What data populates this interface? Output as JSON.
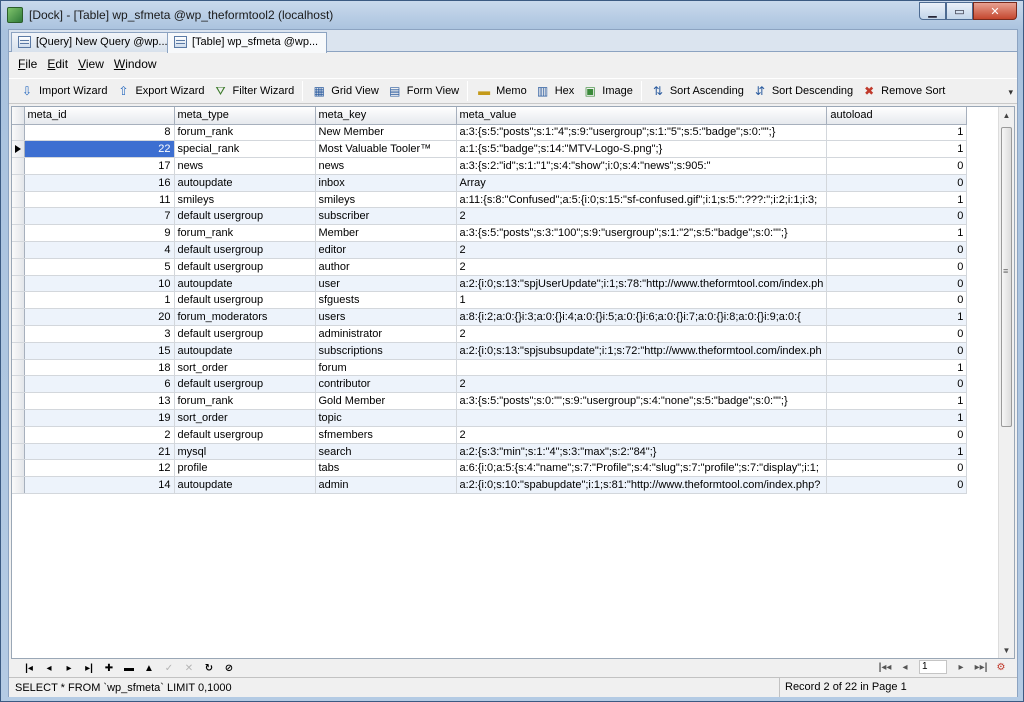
{
  "window": {
    "title": "[Dock] - [Table] wp_sfmeta @wp_theformtool2 (localhost)"
  },
  "tabs": [
    {
      "label": "[Query] New Query @wp..."
    },
    {
      "label": "[Table] wp_sfmeta @wp..."
    }
  ],
  "menu": [
    {
      "label": "File",
      "accel": "F",
      "rest": "ile"
    },
    {
      "label": "Edit",
      "accel": "E",
      "rest": "dit"
    },
    {
      "label": "View",
      "accel": "V",
      "rest": "iew"
    },
    {
      "label": "Window",
      "accel": "W",
      "rest": "indow"
    }
  ],
  "toolbar": {
    "import_wizard": "Import Wizard",
    "export_wizard": "Export Wizard",
    "filter_wizard": "Filter Wizard",
    "grid_view": "Grid View",
    "form_view": "Form View",
    "memo": "Memo",
    "hex": "Hex",
    "image": "Image",
    "sort_ascending": "Sort Ascending",
    "sort_descending": "Sort Descending",
    "remove_sort": "Remove Sort"
  },
  "grid": {
    "columns": [
      "meta_id",
      "meta_type",
      "meta_key",
      "meta_value",
      "autoload"
    ],
    "rows": [
      [
        "8",
        "forum_rank",
        "New Member",
        "a:3:{s:5:\"posts\";s:1:\"4\";s:9:\"usergroup\";s:1:\"5\";s:5:\"badge\";s:0:\"\";}",
        "1"
      ],
      [
        "22",
        "special_rank",
        "Most Valuable Tooler™",
        "a:1:{s:5:\"badge\";s:14:\"MTV-Logo-S.png\";}",
        "1"
      ],
      [
        "17",
        "news",
        "news",
        "a:3:{s:2:\"id\";s:1:\"1\";s:4:\"show\";i:0;s:4:\"news\";s:905:\"",
        "0"
      ],
      [
        "16",
        "autoupdate",
        "inbox",
        "Array",
        "0"
      ],
      [
        "11",
        "smileys",
        "smileys",
        "a:11:{s:8:\"Confused\";a:5:{i:0;s:15:\"sf-confused.gif\";i:1;s:5:\":???:\";i:2;i:1;i:3;",
        "1"
      ],
      [
        "7",
        "default usergroup",
        "subscriber",
        "2",
        "0"
      ],
      [
        "9",
        "forum_rank",
        "Member",
        "a:3:{s:5:\"posts\";s:3:\"100\";s:9:\"usergroup\";s:1:\"2\";s:5:\"badge\";s:0:\"\";}",
        "1"
      ],
      [
        "4",
        "default usergroup",
        "editor",
        "2",
        "0"
      ],
      [
        "5",
        "default usergroup",
        "author",
        "2",
        "0"
      ],
      [
        "10",
        "autoupdate",
        "user",
        "a:2:{i:0;s:13:\"spjUserUpdate\";i:1;s:78:\"http://www.theformtool.com/index.ph",
        "0"
      ],
      [
        "1",
        "default usergroup",
        "sfguests",
        "1",
        "0"
      ],
      [
        "20",
        "forum_moderators",
        "users",
        "a:8:{i:2;a:0:{}i:3;a:0:{}i:4;a:0:{}i:5;a:0:{}i:6;a:0:{}i:7;a:0:{}i:8;a:0:{}i:9;a:0:{",
        "1"
      ],
      [
        "3",
        "default usergroup",
        "administrator",
        "2",
        "0"
      ],
      [
        "15",
        "autoupdate",
        "subscriptions",
        "a:2:{i:0;s:13:\"spjsubsupdate\";i:1;s:72:\"http://www.theformtool.com/index.ph",
        "0"
      ],
      [
        "18",
        "sort_order",
        "forum",
        "",
        "1"
      ],
      [
        "6",
        "default usergroup",
        "contributor",
        "2",
        "0"
      ],
      [
        "13",
        "forum_rank",
        "Gold Member",
        "a:3:{s:5:\"posts\";s:0:\"\";s:9:\"usergroup\";s:4:\"none\";s:5:\"badge\";s:0:\"\";}",
        "1"
      ],
      [
        "19",
        "sort_order",
        "topic",
        "",
        "1"
      ],
      [
        "2",
        "default usergroup",
        "sfmembers",
        "2",
        "0"
      ],
      [
        "21",
        "mysql",
        "search",
        "a:2:{s:3:\"min\";s:1:\"4\";s:3:\"max\";s:2:\"84\";}",
        "1"
      ],
      [
        "12",
        "profile",
        "tabs",
        "a:6:{i:0;a:5:{s:4:\"name\";s:7:\"Profile\";s:4:\"slug\";s:7:\"profile\";s:7:\"display\";i:1;",
        "0"
      ],
      [
        "14",
        "autoupdate",
        "admin",
        "a:2:{i:0;s:10:\"spabupdate\";i:1;s:81:\"http://www.theformtool.com/index.php?",
        "0"
      ]
    ],
    "selected_row": 1
  },
  "navigator": {
    "page_value": "1"
  },
  "status": {
    "sql": "SELECT * FROM `wp_sfmeta` LIMIT 0,1000",
    "record": "Record 2 of 22 in Page 1"
  }
}
